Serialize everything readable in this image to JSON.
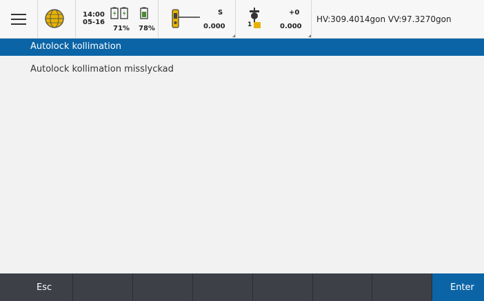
{
  "statusbar": {
    "time": "14:00",
    "date": "05-16",
    "battery_1": "71%",
    "battery_2": "78%",
    "instrument_s": "S",
    "instrument_val": "0.000",
    "target_offset": "+0",
    "target_id": "1",
    "target_val": "0.000",
    "angles": "HV:309.4014gon  VV:97.3270gon"
  },
  "title": "Autolock kollimation",
  "message": "Autolock kollimation misslyckad",
  "softkeys": {
    "esc": "Esc",
    "enter": "Enter"
  },
  "colors": {
    "accent": "#0b64a6",
    "softkey_bar": "#3d4147"
  }
}
